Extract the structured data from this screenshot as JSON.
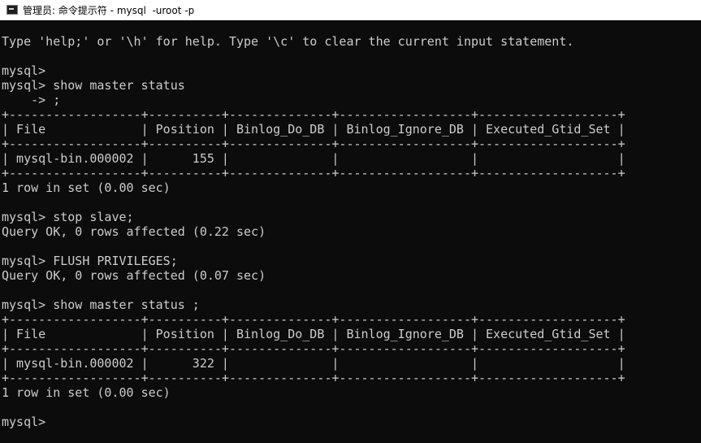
{
  "window": {
    "title": "管理员: 命令提示符 - mysql  -uroot -p",
    "icon": "cmd-icon"
  },
  "console": {
    "lines": [
      "Type 'help;' or '\\h' for help. Type '\\c' to clear the current input statement.",
      "",
      "mysql>",
      "mysql> show master status",
      "    -> ;",
      "+------------------+----------+--------------+------------------+-------------------+",
      "| File             | Position | Binlog_Do_DB | Binlog_Ignore_DB | Executed_Gtid_Set |",
      "+------------------+----------+--------------+------------------+-------------------+",
      "| mysql-bin.000002 |      155 |              |                  |                   |",
      "+------------------+----------+--------------+------------------+-------------------+",
      "1 row in set (0.00 sec)",
      "",
      "mysql> stop slave;",
      "Query OK, 0 rows affected (0.22 sec)",
      "",
      "mysql> FLUSH PRIVILEGES;",
      "Query OK, 0 rows affected (0.07 sec)",
      "",
      "mysql> show master status ;",
      "+------------------+----------+--------------+------------------+-------------------+",
      "| File             | Position | Binlog_Do_DB | Binlog_Ignore_DB | Executed_Gtid_Set |",
      "+------------------+----------+--------------+------------------+-------------------+",
      "| mysql-bin.000002 |      322 |              |                  |                   |",
      "+------------------+----------+--------------+------------------+-------------------+",
      "1 row in set (0.00 sec)",
      "",
      "mysql>"
    ]
  },
  "colors": {
    "background": "#0c0c0c",
    "foreground": "#cccccc",
    "titlebar": "#ffffff"
  }
}
